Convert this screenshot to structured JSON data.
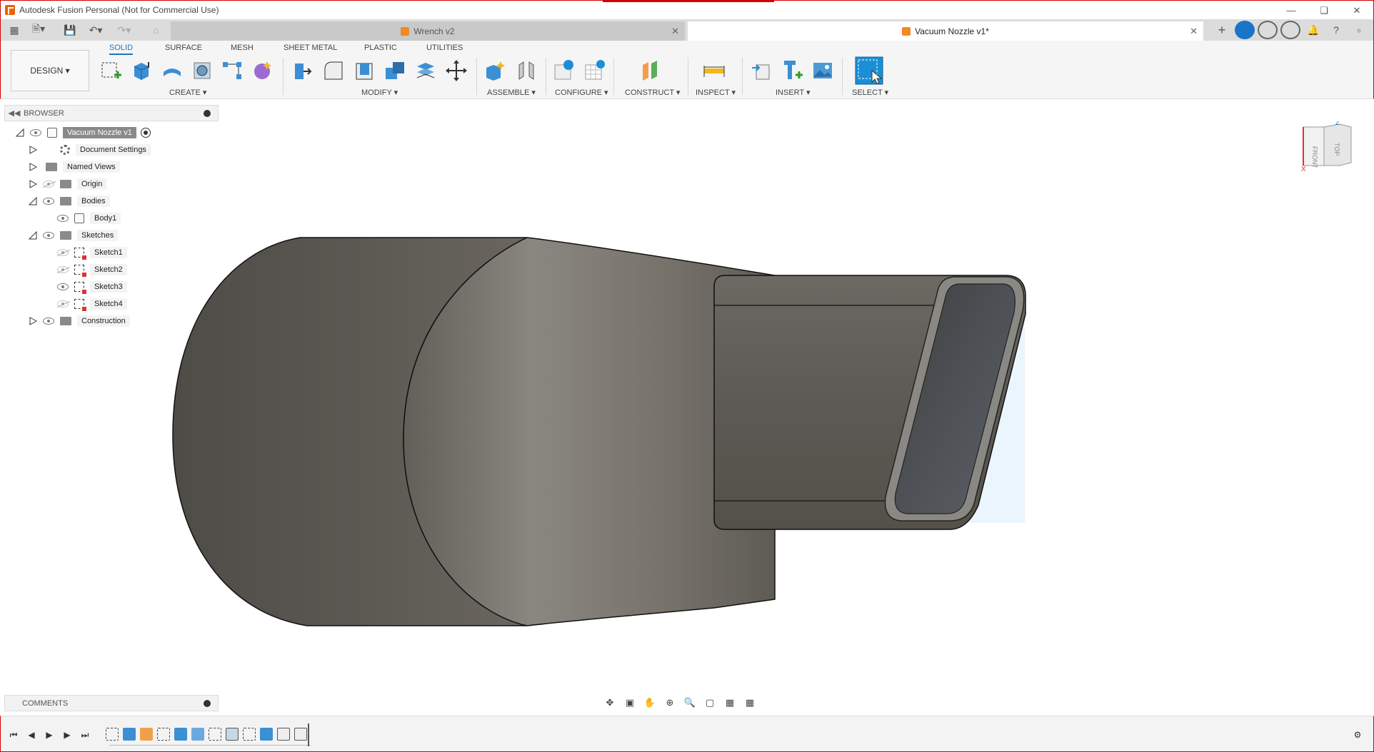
{
  "window": {
    "title": "Autodesk Fusion Personal (Not for Commercial Use)"
  },
  "tabs": [
    {
      "label": "Wrench v2",
      "active": false
    },
    {
      "label": "Vacuum Nozzle v1*",
      "active": true
    }
  ],
  "ribbon": {
    "workspace": "DESIGN",
    "tabs": [
      "SOLID",
      "SURFACE",
      "MESH",
      "SHEET METAL",
      "PLASTIC",
      "UTILITIES"
    ],
    "active_tab": "SOLID",
    "groups": [
      "CREATE",
      "MODIFY",
      "ASSEMBLE",
      "CONFIGURE",
      "CONSTRUCT",
      "INSPECT",
      "INSERT",
      "SELECT"
    ]
  },
  "browser": {
    "title": "BROWSER",
    "root": "Vacuum Nozzle v1",
    "items": [
      {
        "label": "Document Settings",
        "level": 1
      },
      {
        "label": "Named Views",
        "level": 1
      },
      {
        "label": "Origin",
        "level": 1
      },
      {
        "label": "Bodies",
        "level": 1
      },
      {
        "label": "Body1",
        "level": 2
      },
      {
        "label": "Sketches",
        "level": 1
      },
      {
        "label": "Sketch1",
        "level": 2
      },
      {
        "label": "Sketch2",
        "level": 2
      },
      {
        "label": "Sketch3",
        "level": 2
      },
      {
        "label": "Sketch4",
        "level": 2
      },
      {
        "label": "Construction",
        "level": 1
      }
    ]
  },
  "viewcube": {
    "face1": "FRONT",
    "face2": "TOP",
    "axis_z": "Z",
    "axis_x": "X"
  },
  "comments": {
    "title": "COMMENTS"
  },
  "colors": {
    "accent": "#1a74c8",
    "body": "#6e6a63",
    "select_blue": "#1b8fd6"
  }
}
